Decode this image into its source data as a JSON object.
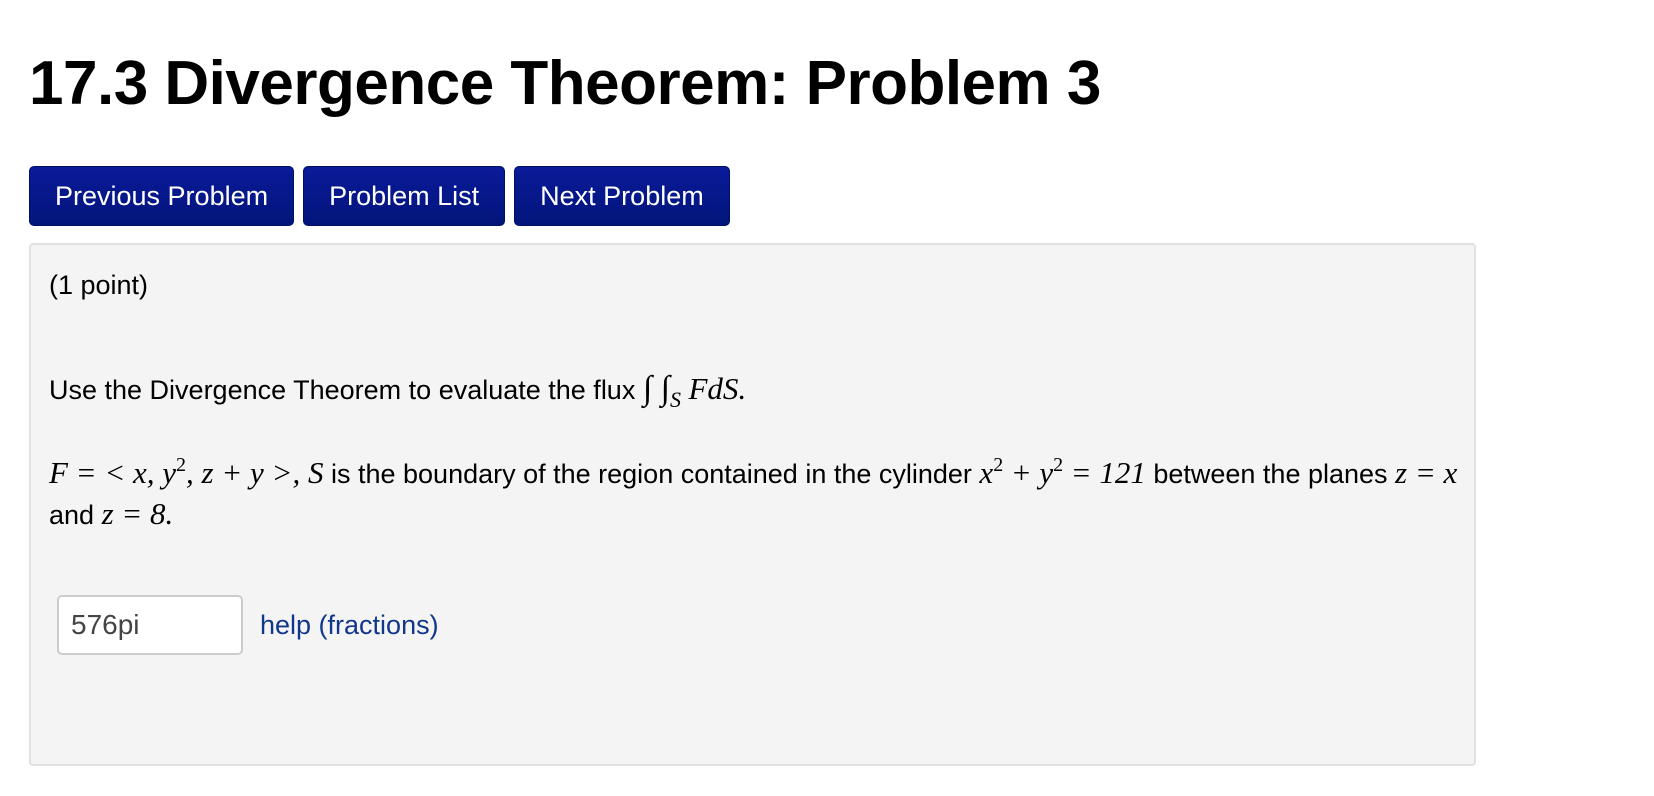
{
  "header": {
    "title": "17.3 Divergence Theorem: Problem 3"
  },
  "nav": {
    "previous_label": "Previous Problem",
    "list_label": "Problem List",
    "next_label": "Next Problem"
  },
  "problem": {
    "points": "(1 point)",
    "prompt_text": "Use the Divergence Theorem to evaluate the flux",
    "flux_integral_symbol": "∫ ∫",
    "flux_integral_sub": "S",
    "flux_integrand": "FdS",
    "flux_end": ".",
    "field_expr_a": "F = < x, y",
    "field_exp_y": "2",
    "field_expr_b": ", z + y >, S",
    "boundary_text": "is the boundary of the region contained in the cylinder",
    "cyl_x": "x",
    "cyl_exp_x": "2",
    "cyl_plus": "+ y",
    "cyl_exp_y": "2",
    "cyl_eq": "= 121",
    "between_text": "between the planes",
    "plane1": "z = x",
    "and_text": "and",
    "plane2": "z = 8.",
    "answer_value": "576pi",
    "help_link": "help (fractions)"
  },
  "colors": {
    "button_bg": "#02157a",
    "link": "#11378a",
    "panel_bg": "#f4f4f4"
  }
}
